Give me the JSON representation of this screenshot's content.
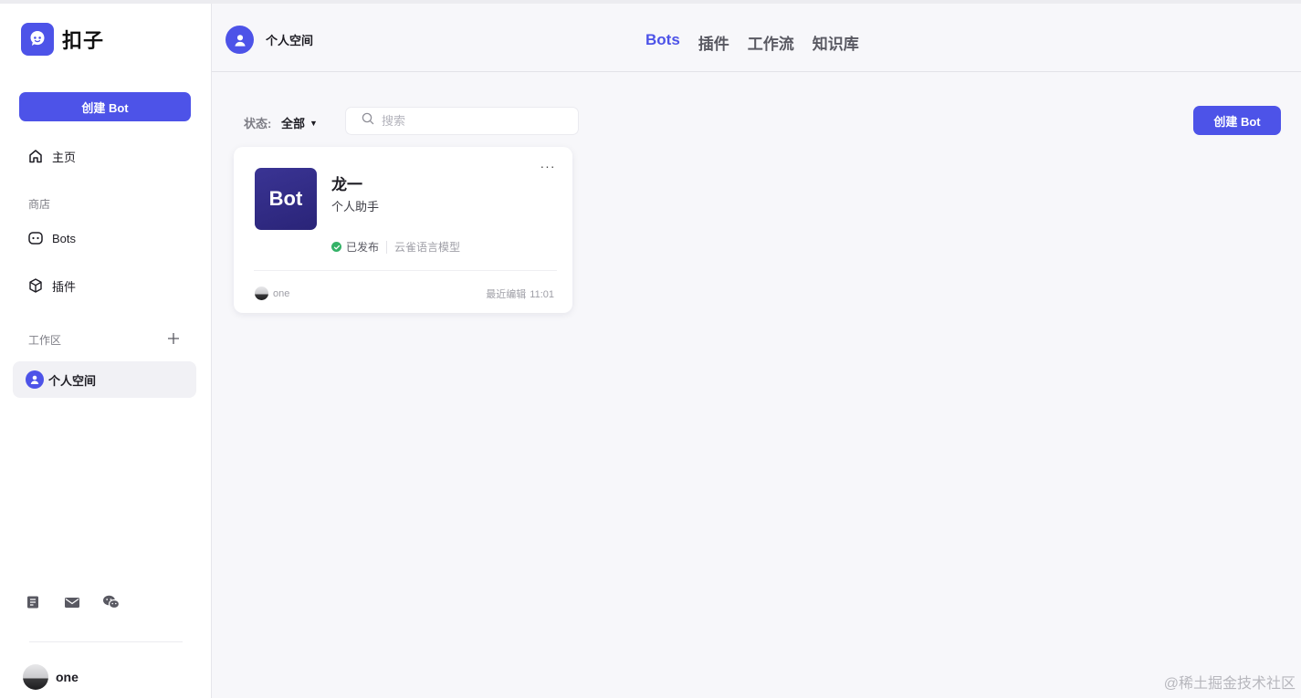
{
  "app": {
    "name": "扣子"
  },
  "sidebar": {
    "create_label": "创建 Bot",
    "home_label": "主页",
    "store_label": "商店",
    "bots_label": "Bots",
    "plugins_label": "插件",
    "workspace_label": "工作区",
    "personal_space_label": "个人空间",
    "footer_icons": [
      "document-icon",
      "mail-icon",
      "wechat-icon"
    ],
    "user_name": "one"
  },
  "header": {
    "space_name": "个人空间",
    "tabs": [
      {
        "label": "Bots",
        "active": true
      },
      {
        "label": "插件",
        "active": false
      },
      {
        "label": "工作流",
        "active": false
      },
      {
        "label": "知识库",
        "active": false
      }
    ]
  },
  "toolbar": {
    "status_label": "状态:",
    "status_value": "全部",
    "search_placeholder": "搜索",
    "create_label": "创建 Bot"
  },
  "bots": [
    {
      "icon_text": "Bot",
      "name": "龙一",
      "description": "个人助手",
      "status": "已发布",
      "model": "云雀语言模型",
      "owner": "one",
      "edited_label": "最近编辑",
      "edited_time": "11:01"
    }
  ],
  "watermark": "@稀土掘金技术社区",
  "colors": {
    "accent": "#4d53e8",
    "published": "#34b267",
    "bot_icon": "#2f2a85"
  }
}
